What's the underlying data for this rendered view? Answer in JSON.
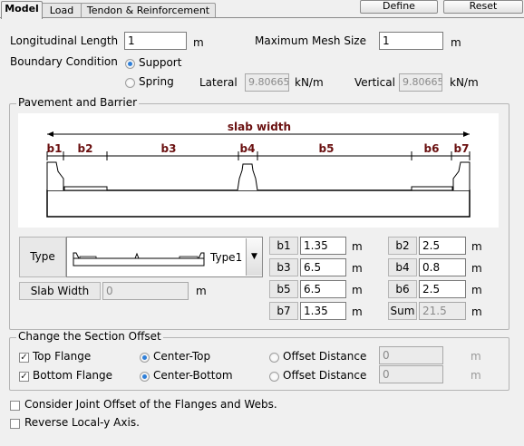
{
  "tabs": [
    "Model",
    "Load",
    "Tendon & Reinforcement"
  ],
  "buttons": {
    "define": "Define",
    "reset": "Reset"
  },
  "general": {
    "long_length_label": "Longitudinal Length",
    "long_length_value": "1",
    "long_length_unit": "m",
    "max_mesh_label": "Maximum Mesh Size",
    "max_mesh_value": "1",
    "max_mesh_unit": "m",
    "boundary_label": "Boundary Condition",
    "support_label": "Support",
    "spring_label": "Spring",
    "lateral_label": "Lateral",
    "lateral_value": "9.80665",
    "lateral_unit": "kN/m",
    "vertical_label": "Vertical",
    "vertical_value": "9.80665",
    "vertical_unit": "kN/m"
  },
  "pavement": {
    "title": "Pavement and Barrier",
    "diagram": {
      "slab_width": "slab width",
      "b_labels": [
        "b1",
        "b2",
        "b3",
        "b4",
        "b5",
        "b6",
        "b7"
      ]
    },
    "type_label": "Type",
    "type_value": "Type1",
    "slab_width_label": "Slab Width",
    "slab_width_value": "0",
    "slab_width_unit": "m",
    "b1_label": "b1",
    "b1_value": "1.35",
    "b1_unit": "m",
    "b2_label": "b2",
    "b2_value": "2.5",
    "b2_unit": "m",
    "b3_label": "b3",
    "b3_value": "6.5",
    "b3_unit": "m",
    "b4_label": "b4",
    "b4_value": "0.8",
    "b4_unit": "m",
    "b5_label": "b5",
    "b5_value": "6.5",
    "b5_unit": "m",
    "b6_label": "b6",
    "b6_value": "2.5",
    "b6_unit": "m",
    "b7_label": "b7",
    "b7_value": "1.35",
    "b7_unit": "m",
    "sum_label": "Sum",
    "sum_value": "21.5",
    "sum_unit": "m"
  },
  "offset": {
    "title": "Change the Section Offset",
    "top_flange": "Top Flange",
    "bottom_flange": "Bottom Flange",
    "center_top": "Center-Top",
    "center_bottom": "Center-Bottom",
    "offset_distance_1": "Offset Distance",
    "offset_distance_2": "Offset Distance",
    "offset_value_1": "0",
    "offset_value_2": "0",
    "offset_unit_1": "m",
    "offset_unit_2": "m"
  },
  "options": {
    "joint_offset": "Consider Joint Offset of the Flanges and Webs.",
    "reverse_axis": "Reverse Local-y Axis."
  },
  "colors": {
    "accent": "#2f7fd8",
    "dimension_text": "#6a1010"
  }
}
